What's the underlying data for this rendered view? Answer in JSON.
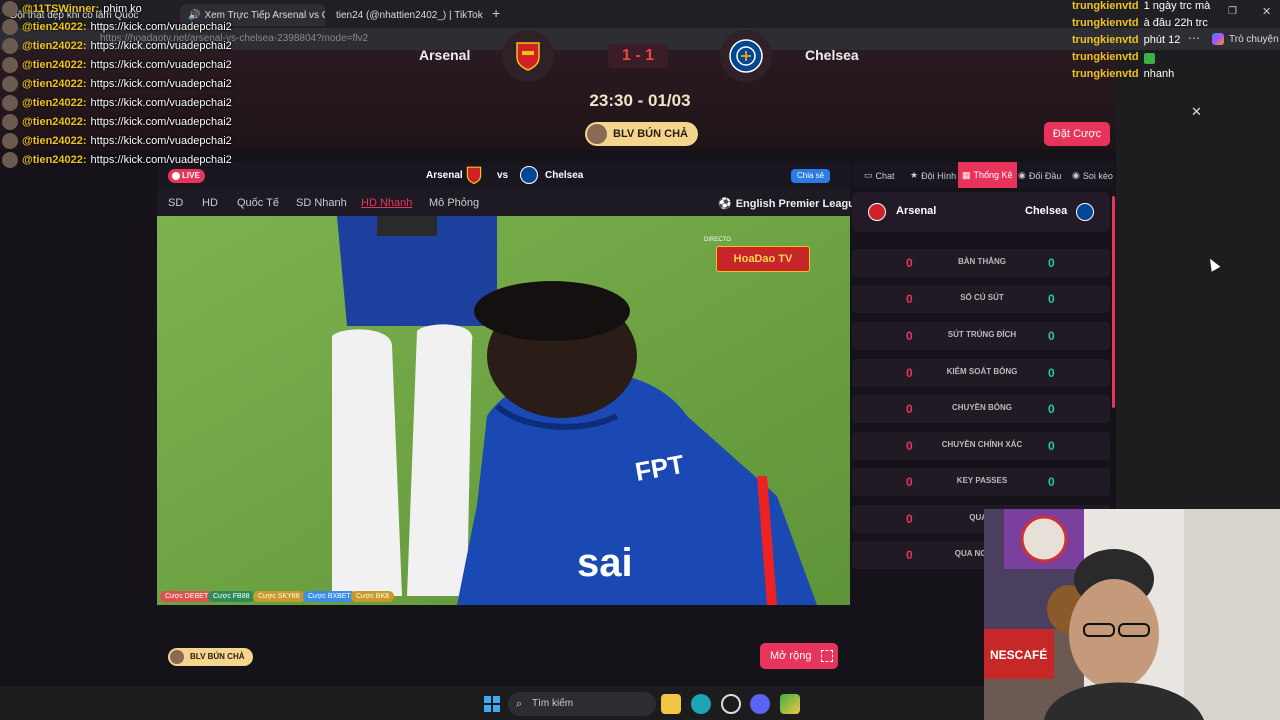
{
  "browser": {
    "tabs": [
      {
        "label": "Đội thật đẹp khi có lâm Quốc",
        "active": false
      },
      {
        "label": "Xem Trực Tiếp Arsenal vs Che",
        "active": true
      },
      {
        "label": "tien24 (@nhattien2402_) | TikTok",
        "active": false
      }
    ],
    "url": "https://hoadaotv.net/arsenal-vs-chelsea-2398804?mode=flv2",
    "copilot_label": "Trò chuyện"
  },
  "match": {
    "home_team": "Arsenal",
    "away_team": "Chelsea",
    "score": "1 - 1",
    "time": "23:30 - 01/03",
    "commentator": "BLV BÚN CHẢ",
    "bet_button": "Đặt Cược"
  },
  "player": {
    "live_label": "LIVE",
    "header_home": "Arsenal",
    "vs": "vs",
    "header_away": "Chelsea",
    "share_label": "Chia sẻ",
    "quality_tabs": [
      "SD",
      "HD",
      "Quốc Tế",
      "SD Nhanh",
      "HD Nhanh",
      "Mô Phỏng"
    ],
    "active_quality": "HD Nhanh",
    "league": "English Premier League",
    "watermark_directo": "DIRECTO",
    "watermark_brand": "HoaDao TV",
    "sponsors": [
      {
        "label": "Cược DEBET",
        "color": "#d9534f"
      },
      {
        "label": "Cược FB88",
        "color": "#2e8b57"
      },
      {
        "label": "Cược SKY88",
        "color": "#c79a2a"
      },
      {
        "label": "Cược BXBET",
        "color": "#3a8ee6"
      },
      {
        "label": "Cược BK8",
        "color": "#c79a2a"
      }
    ],
    "expand_button": "Mở rộng",
    "commentator_bottom": "BLV BÚN CHẢ"
  },
  "stats_panel": {
    "tabs": [
      "Chat",
      "Đội Hình",
      "Thống Kê",
      "Đối Đầu",
      "Soi kèo"
    ],
    "active_tab": "Thống Kê",
    "home": "Arsenal",
    "away": "Chelsea",
    "rows": [
      {
        "label": "BÀN THẮNG",
        "home": "0",
        "away": "0"
      },
      {
        "label": "SỐ CÚ SÚT",
        "home": "0",
        "away": "0"
      },
      {
        "label": "SÚT TRÚNG ĐÍCH",
        "home": "0",
        "away": "0"
      },
      {
        "label": "KIỂM SOÁT BÓNG",
        "home": "0",
        "away": "0"
      },
      {
        "label": "CHUYỀN BÓNG",
        "home": "0",
        "away": "0"
      },
      {
        "label": "CHUYỀN CHÍNH XÁC",
        "home": "0",
        "away": "0"
      },
      {
        "label": "KEY PASSES",
        "home": "0",
        "away": "0"
      },
      {
        "label": "QUA N",
        "home": "0",
        "away": ""
      },
      {
        "label": "QUA NGƯỜI T",
        "home": "0",
        "away": ""
      }
    ]
  },
  "overlay_chat_left": {
    "first": {
      "user": "@11TSWinner:",
      "msg": "phim ko"
    },
    "lines": [
      {
        "user": "@tien24022:",
        "msg": "https://kick.com/vuadepchai2"
      },
      {
        "user": "@tien24022:",
        "msg": "https://kick.com/vuadepchai2"
      },
      {
        "user": "@tien24022:",
        "msg": "https://kick.com/vuadepchai2"
      },
      {
        "user": "@tien24022:",
        "msg": "https://kick.com/vuadepchai2"
      },
      {
        "user": "@tien24022:",
        "msg": "https://kick.com/vuadepchai2"
      },
      {
        "user": "@tien24022:",
        "msg": "https://kick.com/vuadepchai2"
      },
      {
        "user": "@tien24022:",
        "msg": "https://kick.com/vuadepchai2"
      },
      {
        "user": "@tien24022:",
        "msg": "https://kick.com/vuadepchai2"
      }
    ]
  },
  "overlay_chat_right": [
    {
      "user": "trungkienvtd",
      "msg": "1 ngày trc mà"
    },
    {
      "user": "trungkienvtd",
      "msg": "à đâu 22h trc"
    },
    {
      "user": "trungkienvtd",
      "msg": "phút 12"
    },
    {
      "user": "trungkienvtd",
      "msg": ""
    },
    {
      "user": "trungkienvtd",
      "msg": "nhanh"
    }
  ],
  "taskbar": {
    "search_placeholder": "Tìm kiếm"
  },
  "colors": {
    "accent": "#e8345a",
    "away_stat": "#31c4a5",
    "chat_user": "#f0c419"
  }
}
